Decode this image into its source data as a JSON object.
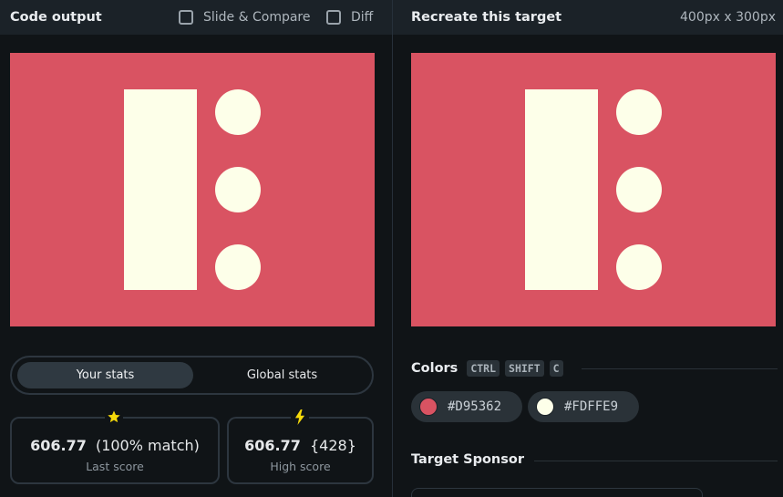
{
  "left_panel": {
    "title": "Code output",
    "options": [
      {
        "label": "Slide & Compare",
        "checked": false
      },
      {
        "label": "Diff",
        "checked": false
      }
    ]
  },
  "right_panel": {
    "title": "Recreate this target",
    "dimensions": "400px x 300px"
  },
  "canvas": {
    "background": "#D95362",
    "foreground": "#FDFFE9"
  },
  "stats": {
    "tabs": {
      "active": "Your stats",
      "other": "Global stats"
    },
    "last_score": {
      "value": "606.77",
      "detail": "(100% match)",
      "label": "Last score",
      "icon": "star-icon"
    },
    "high_score": {
      "value": "606.77",
      "detail": "{428}",
      "label": "High score",
      "icon": "lightning-icon"
    }
  },
  "colors": {
    "label": "Colors",
    "shortcut": [
      "CTRL",
      "SHIFT",
      "C"
    ],
    "swatches": [
      {
        "hex": "#D95362"
      },
      {
        "hex": "#FDFFE9"
      }
    ]
  },
  "sponsor": {
    "label": "Target Sponsor"
  },
  "accent": {
    "star": "#F5D90A"
  }
}
